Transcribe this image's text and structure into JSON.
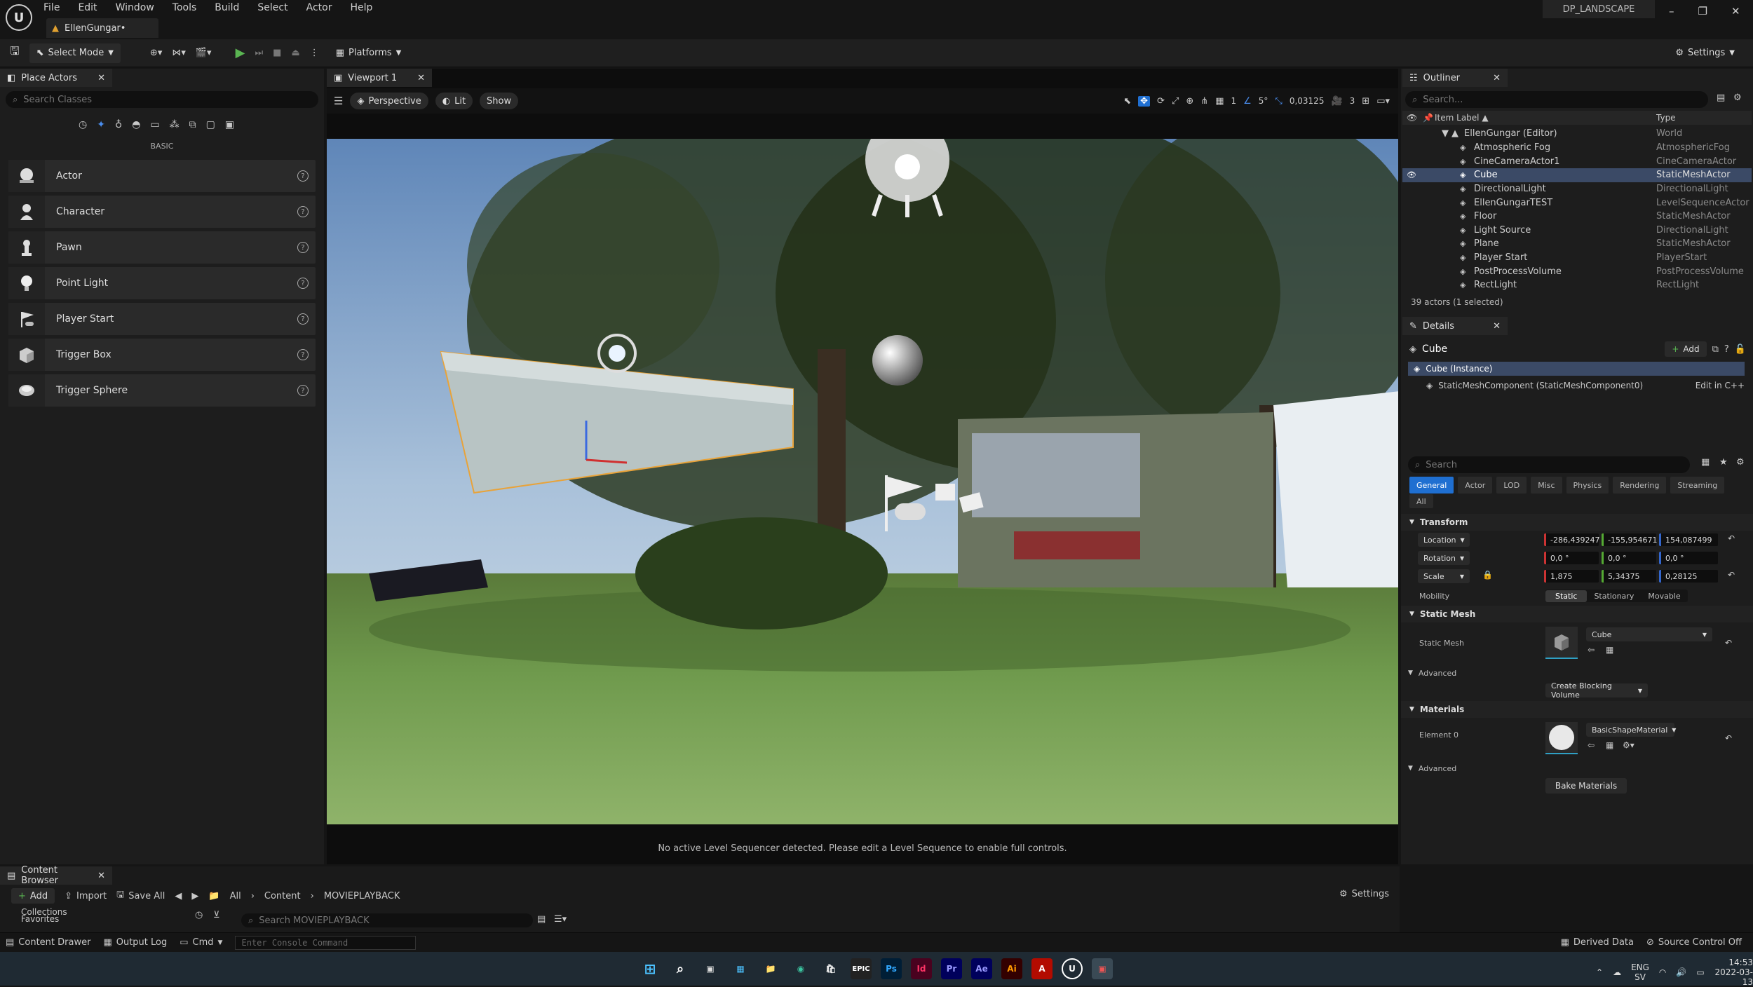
{
  "menu": [
    "File",
    "Edit",
    "Window",
    "Tools",
    "Build",
    "Select",
    "Actor",
    "Help"
  ],
  "document_tab": "EllenGungar•",
  "project_name": "DP_LANDSCAPE",
  "window_controls": [
    "–",
    "❐",
    "✕"
  ],
  "toolbar": {
    "select_mode": "Select Mode",
    "platforms": "Platforms",
    "settings": "Settings"
  },
  "place_actors": {
    "tab_title": "Place Actors",
    "search_placeholder": "Search Classes",
    "category": "BASIC",
    "items": [
      {
        "label": "Actor",
        "icon": "actor-icon"
      },
      {
        "label": "Character",
        "icon": "character-icon"
      },
      {
        "label": "Pawn",
        "icon": "pawn-icon"
      },
      {
        "label": "Point Light",
        "icon": "point-light-icon"
      },
      {
        "label": "Player Start",
        "icon": "player-start-icon"
      },
      {
        "label": "Trigger Box",
        "icon": "trigger-box-icon"
      },
      {
        "label": "Trigger Sphere",
        "icon": "trigger-sphere-icon"
      }
    ]
  },
  "viewport": {
    "tab_title": "Viewport 1",
    "perspective": "Perspective",
    "lit": "Lit",
    "show": "Show",
    "grid_value": "1",
    "angle_value": "5°",
    "scale_value": "0,03125",
    "camera_speed": "3",
    "message": "No active Level Sequencer detected. Please edit a Level Sequence to enable full controls."
  },
  "outliner": {
    "tab_title": "Outliner",
    "search_placeholder": "Search...",
    "col_label": "Item Label ▲",
    "col_type": "Type",
    "root": {
      "label": "EllenGungar (Editor)",
      "type": "World"
    },
    "rows": [
      {
        "label": "Atmospheric Fog",
        "type": "AtmosphericFog"
      },
      {
        "label": "CineCameraActor1",
        "type": "CineCameraActor"
      },
      {
        "label": "Cube",
        "type": "StaticMeshActor"
      },
      {
        "label": "DirectionalLight",
        "type": "DirectionalLight"
      },
      {
        "label": "EllenGungarTEST",
        "type": "LevelSequenceActor"
      },
      {
        "label": "Floor",
        "type": "StaticMeshActor"
      },
      {
        "label": "Light Source",
        "type": "DirectionalLight"
      },
      {
        "label": "Plane",
        "type": "StaticMeshActor"
      },
      {
        "label": "Player Start",
        "type": "PlayerStart"
      },
      {
        "label": "PostProcessVolume",
        "type": "PostProcessVolume"
      },
      {
        "label": "RectLight",
        "type": "RectLight"
      }
    ],
    "selected_index": 2,
    "footer": "39 actors (1 selected)"
  },
  "details": {
    "tab_title": "Details",
    "object_name": "Cube",
    "add_label": "Add",
    "instance": "Cube (Instance)",
    "component": "StaticMeshComponent (StaticMeshComponent0)",
    "edit_in_cpp": "Edit in C++",
    "search_placeholder": "Search",
    "categories": [
      "General",
      "Actor",
      "LOD",
      "Misc",
      "Physics",
      "Rendering",
      "Streaming",
      "All"
    ],
    "transform_header": "Transform",
    "location_label": "Location",
    "location": [
      "-286,439247",
      "-155,954671",
      "154,087499"
    ],
    "rotation_label": "Rotation",
    "rotation": [
      "0,0 °",
      "0,0 °",
      "0,0 °"
    ],
    "scale_label": "Scale",
    "scale": [
      "1,875",
      "5,34375",
      "0,28125"
    ],
    "mobility_label": "Mobility",
    "mobility_options": [
      "Static",
      "Stationary",
      "Movable"
    ],
    "static_mesh_header": "Static Mesh",
    "static_mesh_label": "Static Mesh",
    "static_mesh_value": "Cube",
    "advanced_label": "Advanced",
    "create_blocking": "Create Blocking Volume",
    "materials_header": "Materials",
    "element0_label": "Element 0",
    "material_value": "BasicShapeMaterial",
    "advanced2_label": "Advanced",
    "bake_materials": "Bake Materials"
  },
  "content_browser": {
    "tab_title": "Content Browser",
    "add": "Add",
    "import": "Import",
    "save_all": "Save All",
    "path": [
      "All",
      "Content",
      "MOVIEPLAYBACK"
    ],
    "settings": "Settings",
    "collections": "Collections",
    "favorites": "Favorites",
    "search_placeholder": "Search MOVIEPLAYBACK"
  },
  "statusbar": {
    "content_drawer": "Content Drawer",
    "output_log": "Output Log",
    "cmd": "Cmd",
    "console_placeholder": "Enter Console Command",
    "derived_data": "Derived Data",
    "source_control": "Source Control Off"
  },
  "taskbar": {
    "lang": "ENG",
    "lang2": "SV",
    "time": "14:53",
    "date": "2022-03-13",
    "apps": [
      {
        "label": "Ps",
        "color": "#31a8ff",
        "bg": "#001e36"
      },
      {
        "label": "Id",
        "color": "#ff3366",
        "bg": "#49021f"
      },
      {
        "label": "Pr",
        "color": "#9999ff",
        "bg": "#00005b"
      },
      {
        "label": "Ae",
        "color": "#9999ff",
        "bg": "#00005b"
      },
      {
        "label": "Ai",
        "color": "#ff9a00",
        "bg": "#330000"
      }
    ]
  },
  "colors": {
    "accent": "#1f6fd1",
    "selection": "#3b4a66",
    "panel": "#1d1d1d"
  }
}
